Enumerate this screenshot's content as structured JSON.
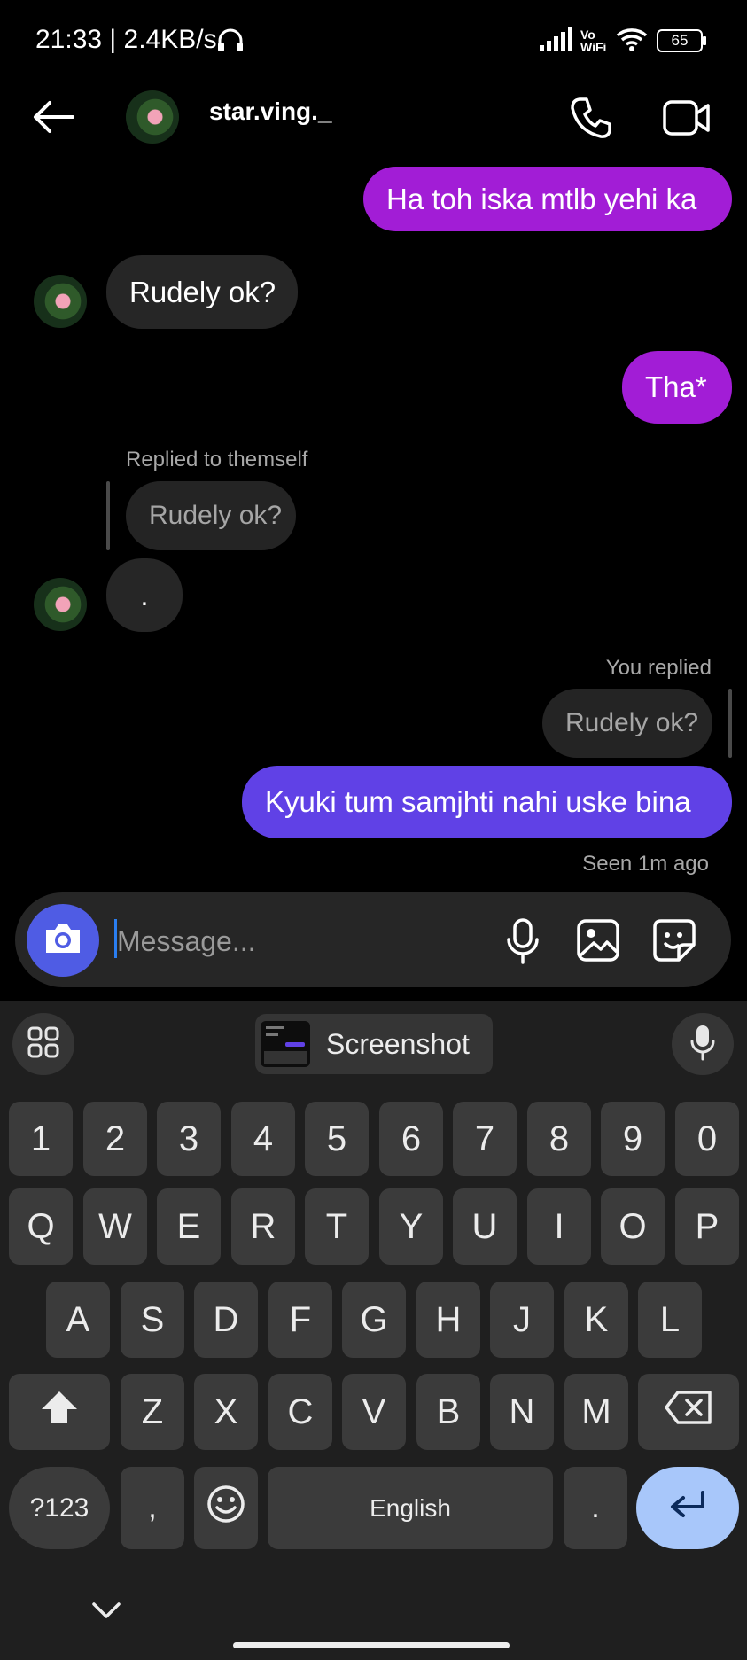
{
  "status_bar": {
    "time": "21:33 | 2.4KB/s",
    "network": "Vo WiFi",
    "battery": "65"
  },
  "header": {
    "username": "star.ving._"
  },
  "messages": {
    "out1": "Ha toh iska mtlb yehi ka",
    "in1": "Rudely ok?",
    "out2": "Tha*",
    "reply_meta_them": "Replied to themself",
    "quoted_them": "Rudely ok?",
    "in2": ".",
    "reply_meta_you": "You replied",
    "quoted_you": "Rudely ok?",
    "out3": "Kyuki tum samjhti nahi uske bina",
    "seen": "Seen 1m ago"
  },
  "composer": {
    "placeholder": "Message..."
  },
  "keyboard": {
    "suggestion": "Screenshot",
    "row_numbers": [
      "1",
      "2",
      "3",
      "4",
      "5",
      "6",
      "7",
      "8",
      "9",
      "0"
    ],
    "row1": [
      "Q",
      "W",
      "E",
      "R",
      "T",
      "Y",
      "U",
      "I",
      "O",
      "P"
    ],
    "row2": [
      "A",
      "S",
      "D",
      "F",
      "G",
      "H",
      "J",
      "K",
      "L"
    ],
    "row3": [
      "Z",
      "X",
      "C",
      "V",
      "B",
      "N",
      "M"
    ],
    "symbols": "?123",
    "comma": ",",
    "space": "English",
    "period": "."
  },
  "colors": {
    "outgoing_purple": "#a21dd6",
    "outgoing_violet": "#6041e6",
    "incoming": "#262626",
    "camera": "#4f5ce4",
    "enter": "#a8c7fa"
  }
}
